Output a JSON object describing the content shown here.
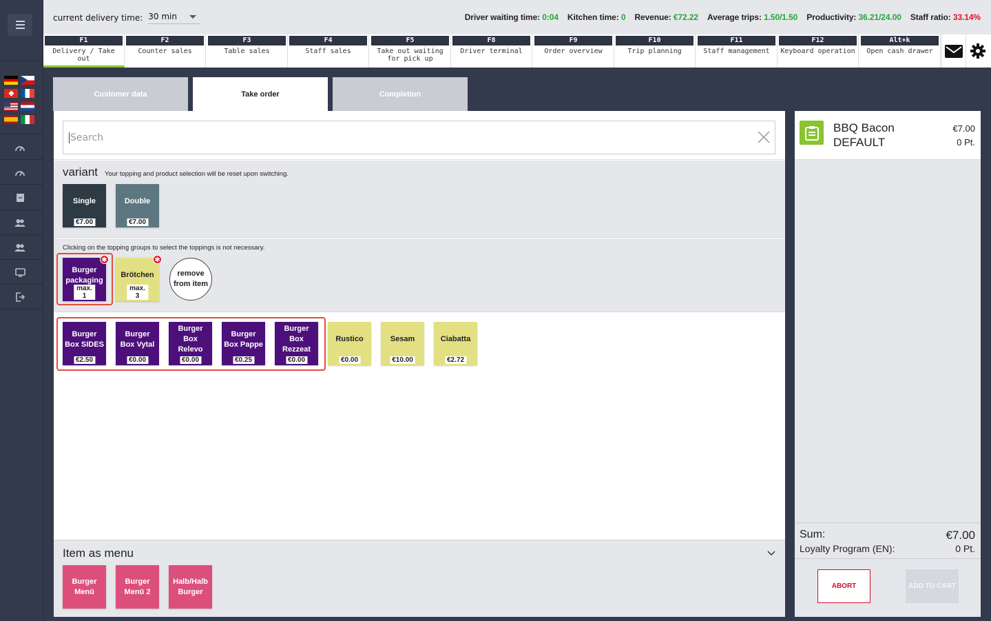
{
  "header": {
    "delivery_label": "current delivery time:",
    "delivery_value": "30 min",
    "stats": [
      {
        "label": "Driver waiting time:",
        "value": "0:04",
        "color": "green"
      },
      {
        "label": "Kitchen time:",
        "value": "0",
        "color": "green"
      },
      {
        "label": "Revenue:",
        "value": "€72.22",
        "color": "green"
      },
      {
        "label": "Average trips:",
        "value": "1.50/1.50",
        "color": "green"
      },
      {
        "label": "Productivity:",
        "value": "36.21/24.00",
        "color": "green"
      },
      {
        "label": "Staff ratio:",
        "value": "33.14%",
        "color": "red"
      }
    ]
  },
  "fkeys": [
    {
      "key": "F1",
      "label": "Delivery / Take out",
      "active": true
    },
    {
      "key": "F2",
      "label": "Counter sales"
    },
    {
      "key": "F3",
      "label": "Table sales"
    },
    {
      "key": "F4",
      "label": "Staff sales"
    },
    {
      "key": "F5",
      "label": "Take out waiting for pick up"
    },
    {
      "key": "F8",
      "label": "Driver terminal"
    },
    {
      "key": "F9",
      "label": "Order overview"
    },
    {
      "key": "F10",
      "label": "Trip planning"
    },
    {
      "key": "F11",
      "label": "Staff management"
    },
    {
      "key": "F12",
      "label": "Keyboard operation"
    },
    {
      "key": "Alt+k",
      "label": "Open cash drawer"
    }
  ],
  "icons": {
    "mail": "envelope-icon",
    "settings": "gear-icon"
  },
  "tabs": [
    {
      "label": "Customer data",
      "active": false
    },
    {
      "label": "Take order",
      "active": true
    },
    {
      "label": "Completion",
      "active": false
    }
  ],
  "search": {
    "placeholder": "Search"
  },
  "variant": {
    "title": "variant",
    "note": "Your topping and product selection will be reset upon switching.",
    "options": [
      {
        "name": "Single",
        "price": "€7.00"
      },
      {
        "name": "Double",
        "price": "€7.00"
      }
    ]
  },
  "toppings": {
    "note": "Clicking on the topping groups to select the toppings is not necessary.",
    "groups": [
      {
        "name": "Burger packaging",
        "limit": "max. 1"
      },
      {
        "name": "Brötchen",
        "limit": "max. 3"
      }
    ],
    "remove_label": "remove from item"
  },
  "products": [
    {
      "name": "Burger Box SIDES",
      "price": "€2.50"
    },
    {
      "name": "Burger Box Vytal",
      "price": "€0.00"
    },
    {
      "name": "Burger Box Relevo",
      "price": "€0.00"
    },
    {
      "name": "Burger Box Pappe",
      "price": "€0.25"
    },
    {
      "name": "Burger Box Rezzeat",
      "price": "€0.00"
    },
    {
      "name": "Rustico",
      "price": "€0.00"
    },
    {
      "name": "Sesam",
      "price": "€10.00"
    },
    {
      "name": "Ciabatta",
      "price": "€2.72"
    }
  ],
  "menu": {
    "title": "Item as menu",
    "items": [
      {
        "name": "Burger Menü"
      },
      {
        "name": "Burger Menü 2"
      },
      {
        "name": "Halb/Halb Burger"
      }
    ]
  },
  "cart": {
    "item_name": "BBQ Bacon",
    "item_variant": "DEFAULT",
    "item_price": "€7.00",
    "item_points": "0 Pt.",
    "sum_label": "Sum:",
    "sum_value": "€7.00",
    "loyalty_label": "Loyalty Program (EN):",
    "loyalty_value": "0 Pt.",
    "abort_label": "ABORT",
    "add_label": "ADD TO CART"
  },
  "colors": {
    "accent_green": "#8ac42f",
    "purple": "#4d0f7a",
    "yellow": "#e3e083",
    "pink": "#dc4f7c",
    "red": "#e0142e"
  }
}
